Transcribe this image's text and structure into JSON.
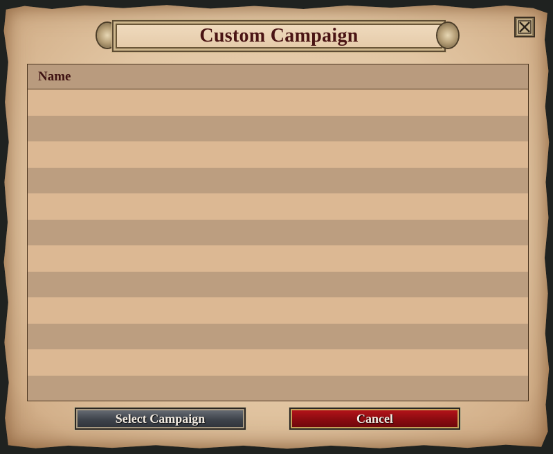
{
  "dialog": {
    "title": "Custom Campaign",
    "close_icon": "close-icon"
  },
  "table": {
    "columns": [
      "Name"
    ],
    "rows": []
  },
  "buttons": {
    "select_label": "Select Campaign",
    "cancel_label": "Cancel"
  },
  "colors": {
    "title_text": "#4a1414",
    "row_light": "#dcb893",
    "row_dark": "#bc9e80",
    "header_bg": "#b99b7e",
    "cancel_red": "#8a0b10",
    "select_gray": "#3e434b"
  }
}
